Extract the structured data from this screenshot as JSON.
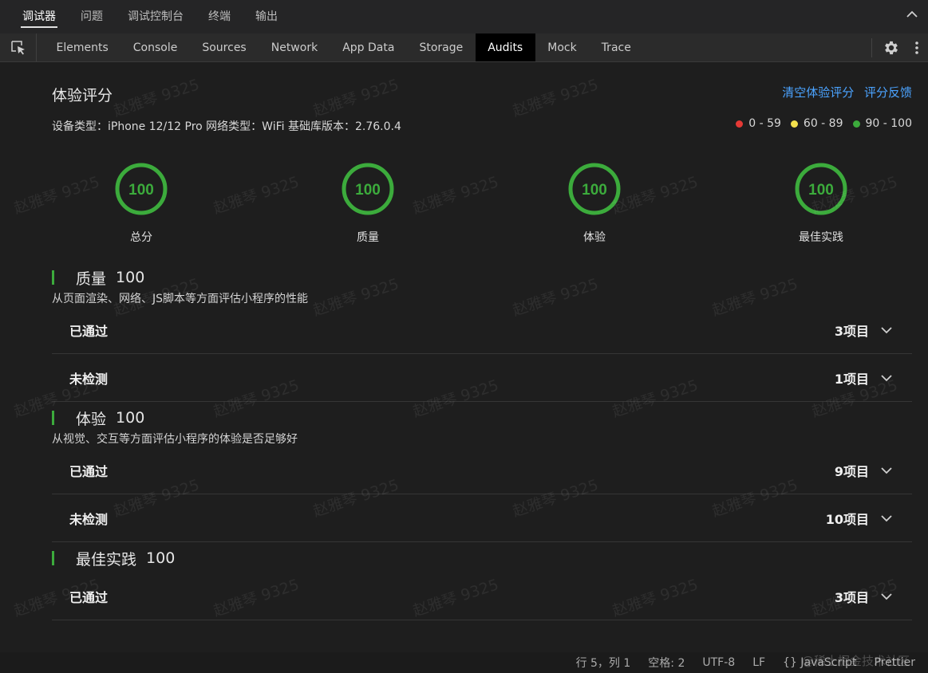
{
  "top_tabs": [
    "调试器",
    "问题",
    "调试控制台",
    "终端",
    "输出"
  ],
  "panel_tabs": [
    "Elements",
    "Console",
    "Sources",
    "Network",
    "App Data",
    "Storage",
    "Audits",
    "Mock",
    "Trace"
  ],
  "audit": {
    "title": "体验评分",
    "device_info": "设备类型：iPhone 12/12 Pro 网络类型：WiFi 基础库版本：2.76.0.4",
    "links": {
      "clear": "清空体验评分",
      "feedback": "评分反馈"
    },
    "legend": [
      {
        "range": "0 - 59",
        "color": "#e53935"
      },
      {
        "range": "60 - 89",
        "color": "#f4e04d"
      },
      {
        "range": "90 - 100",
        "color": "#3cab3c"
      }
    ],
    "gauges": [
      {
        "label": "总分",
        "score": "100",
        "fill": 1.0
      },
      {
        "label": "质量",
        "score": "100",
        "fill": 1.0
      },
      {
        "label": "体验",
        "score": "100",
        "fill": 1.0
      },
      {
        "label": "最佳实践",
        "score": "100",
        "fill": 1.0
      }
    ],
    "categories": [
      {
        "title": "质量",
        "score": "100",
        "desc": "从页面渲染、网络、JS脚本等方面评估小程序的性能",
        "rows": [
          {
            "label": "已通过",
            "count": "3项目"
          },
          {
            "label": "未检测",
            "count": "1项目"
          }
        ]
      },
      {
        "title": "体验",
        "score": "100",
        "desc": "从视觉、交互等方面评估小程序的体验是否足够好",
        "rows": [
          {
            "label": "已通过",
            "count": "9项目"
          },
          {
            "label": "未检测",
            "count": "10项目"
          }
        ]
      },
      {
        "title": "最佳实践",
        "score": "100",
        "desc": "",
        "rows": [
          {
            "label": "已通过",
            "count": "3项目"
          }
        ]
      }
    ]
  },
  "status_bar": {
    "position": "行 5，列 1",
    "spaces": "空格: 2",
    "encoding": "UTF-8",
    "eol": "LF",
    "language": "{} JavaScript",
    "formatter": "Prettier"
  },
  "watermark_text": "赵雅琴 9325",
  "corner_watermark": "@稀土掘金技术社区",
  "accent_color": "#3cab3c",
  "link_color": "#4ba3ff"
}
